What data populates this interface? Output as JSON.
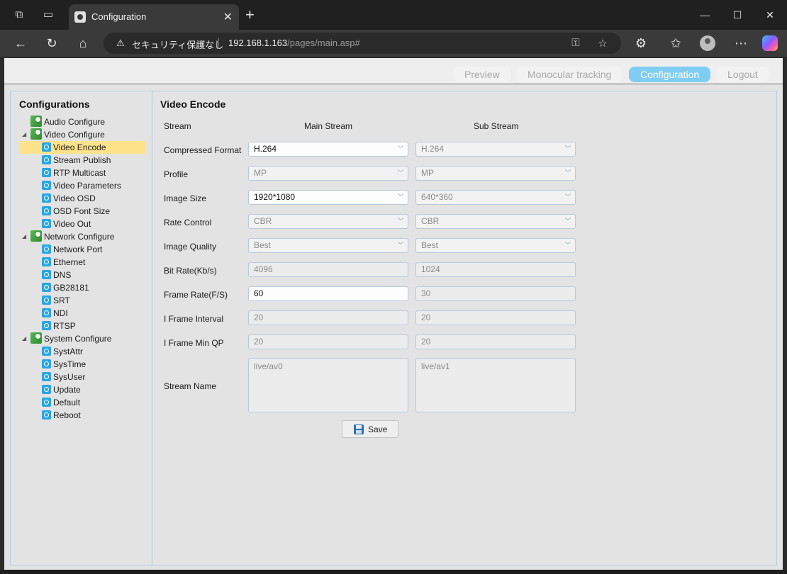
{
  "browser": {
    "tab_title": "Configuration",
    "security_warning": "セキュリティ保護なし",
    "url_host": "192.168.1.163",
    "url_path": "/pages/main.asp#"
  },
  "topnav": {
    "items": [
      {
        "label": "Preview",
        "active": false
      },
      {
        "label": "Monocular tracking",
        "active": false
      },
      {
        "label": "Configuration",
        "active": true
      },
      {
        "label": "Logout",
        "active": false
      }
    ]
  },
  "sidebar": {
    "title": "Configurations",
    "audio": "Audio Configure",
    "video": {
      "label": "Video Configure",
      "items": [
        "Video Encode",
        "Stream Publish",
        "RTP Multicast",
        "Video Parameters",
        "Video OSD",
        "OSD Font Size",
        "Video Out"
      ]
    },
    "network": {
      "label": "Network Configure",
      "items": [
        "Network Port",
        "Ethernet",
        "DNS",
        "GB28181",
        "SRT",
        "NDI",
        "RTSP"
      ]
    },
    "system": {
      "label": "System Configure",
      "items": [
        "SystAttr",
        "SysTime",
        "SysUser",
        "Update",
        "Default",
        "Reboot"
      ]
    },
    "selected": "Video Encode"
  },
  "form": {
    "title": "Video Encode",
    "header_stream": "Stream",
    "header_main": "Main Stream",
    "header_sub": "Sub Stream",
    "labels": {
      "compressed_format": "Compressed Format",
      "profile": "Profile",
      "image_size": "Image Size",
      "rate_control": "Rate Control",
      "image_quality": "Image Quality",
      "bit_rate": "Bit Rate(Kb/s)",
      "frame_rate": "Frame Rate(F/S)",
      "i_frame_interval": "I Frame Interval",
      "i_frame_min_qp": "I Frame Min QP",
      "stream_name": "Stream Name"
    },
    "main": {
      "compressed_format": "H.264",
      "profile": "MP",
      "image_size": "1920*1080",
      "rate_control": "CBR",
      "image_quality": "Best",
      "bit_rate": "4096",
      "frame_rate": "60",
      "i_frame_interval": "20",
      "i_frame_min_qp": "20",
      "stream_name": "live/av0"
    },
    "sub": {
      "compressed_format": "H.264",
      "profile": "MP",
      "image_size": "640*360",
      "rate_control": "CBR",
      "image_quality": "Best",
      "bit_rate": "1024",
      "frame_rate": "30",
      "i_frame_interval": "20",
      "i_frame_min_qp": "20",
      "stream_name": "live/av1"
    },
    "save_label": "Save"
  },
  "colors": {
    "accent": "#7fcdf2",
    "selected_row": "#ffe38a",
    "frame_border": "#b7cde3"
  }
}
